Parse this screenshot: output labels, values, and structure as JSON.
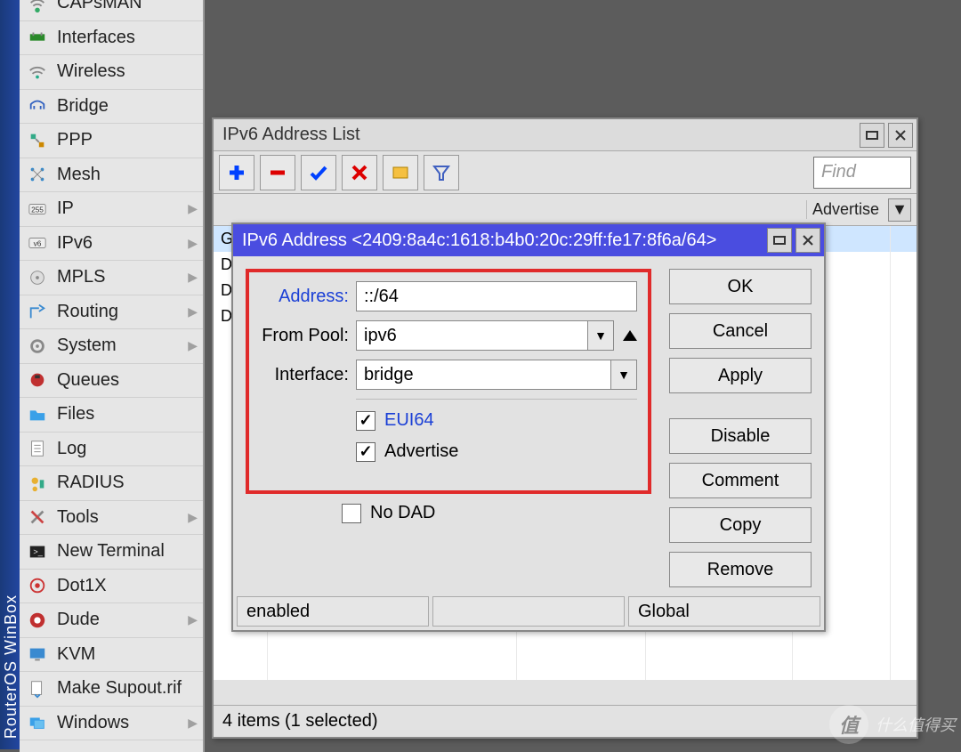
{
  "app": {
    "product": "RouterOS WinBox"
  },
  "sidebar": {
    "items": [
      {
        "label": "CAPsMAN",
        "submenu": false,
        "icon": "capsman-icon"
      },
      {
        "label": "Interfaces",
        "submenu": false,
        "icon": "interfaces-icon"
      },
      {
        "label": "Wireless",
        "submenu": false,
        "icon": "wireless-icon"
      },
      {
        "label": "Bridge",
        "submenu": false,
        "icon": "bridge-icon"
      },
      {
        "label": "PPP",
        "submenu": false,
        "icon": "ppp-icon"
      },
      {
        "label": "Mesh",
        "submenu": false,
        "icon": "mesh-icon"
      },
      {
        "label": "IP",
        "submenu": true,
        "icon": "ip-icon"
      },
      {
        "label": "IPv6",
        "submenu": true,
        "icon": "ipv6-icon"
      },
      {
        "label": "MPLS",
        "submenu": true,
        "icon": "mpls-icon"
      },
      {
        "label": "Routing",
        "submenu": true,
        "icon": "routing-icon"
      },
      {
        "label": "System",
        "submenu": true,
        "icon": "system-icon"
      },
      {
        "label": "Queues",
        "submenu": false,
        "icon": "queues-icon"
      },
      {
        "label": "Files",
        "submenu": false,
        "icon": "files-icon"
      },
      {
        "label": "Log",
        "submenu": false,
        "icon": "log-icon"
      },
      {
        "label": "RADIUS",
        "submenu": false,
        "icon": "radius-icon"
      },
      {
        "label": "Tools",
        "submenu": true,
        "icon": "tools-icon"
      },
      {
        "label": "New Terminal",
        "submenu": false,
        "icon": "terminal-icon"
      },
      {
        "label": "Dot1X",
        "submenu": false,
        "icon": "dot1x-icon"
      },
      {
        "label": "Dude",
        "submenu": true,
        "icon": "dude-icon"
      },
      {
        "label": "KVM",
        "submenu": false,
        "icon": "kvm-icon"
      },
      {
        "label": "Make Supout.rif",
        "submenu": false,
        "icon": "supout-icon"
      },
      {
        "label": "Windows",
        "submenu": true,
        "icon": "windows-icon"
      }
    ]
  },
  "list_window": {
    "title": "IPv6 Address List",
    "find_placeholder": "Find",
    "columns": {
      "advertise": "Advertise"
    },
    "rows": [
      {
        "flag": "G",
        "selected": true
      },
      {
        "flag": "D"
      },
      {
        "flag": "D"
      },
      {
        "flag": "D"
      }
    ],
    "status": "4 items (1 selected)"
  },
  "dialog": {
    "title": "IPv6 Address <2409:8a4c:1618:b4b0:20c:29ff:fe17:8f6a/64>",
    "labels": {
      "address": "Address:",
      "from_pool": "From Pool:",
      "interface": "Interface:",
      "eui64": "EUI64",
      "advertise": "Advertise",
      "no_dad": "No DAD"
    },
    "values": {
      "address": "::/64",
      "from_pool": "ipv6",
      "interface": "bridge",
      "eui64": true,
      "advertise": true,
      "no_dad": false
    },
    "buttons": {
      "ok": "OK",
      "cancel": "Cancel",
      "apply": "Apply",
      "disable": "Disable",
      "comment": "Comment",
      "copy": "Copy",
      "remove": "Remove"
    },
    "status": {
      "left": "enabled",
      "mid": "",
      "right": "Global"
    }
  },
  "watermark": {
    "badge": "值",
    "text": "什么值得买"
  }
}
